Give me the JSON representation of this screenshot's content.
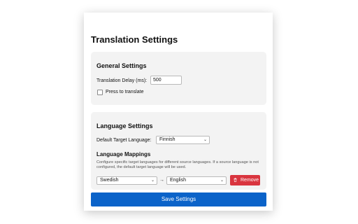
{
  "page": {
    "title": "Translation Settings"
  },
  "general": {
    "title": "General Settings",
    "delay_label": "Translation Delay (ms):",
    "delay_value": "500",
    "press_label": "Press to translate",
    "press_checked": false
  },
  "language": {
    "title": "Language Settings",
    "default_label": "Default Target Language:",
    "default_value": "Finnish",
    "mappings_title": "Language Mappings",
    "mappings_desc": "Configure specific target languages for different source languages. If a source language is not configured, the default target language will be used.",
    "mapping_rows": [
      {
        "source": "Swedish",
        "arrow": "→",
        "target": "English",
        "remove_label": "Remove"
      }
    ]
  },
  "actions": {
    "save_label": "Save Settings"
  },
  "colors": {
    "save": "#0b63c9",
    "remove": "#d9353f",
    "section_bg": "#f3f3f3"
  }
}
